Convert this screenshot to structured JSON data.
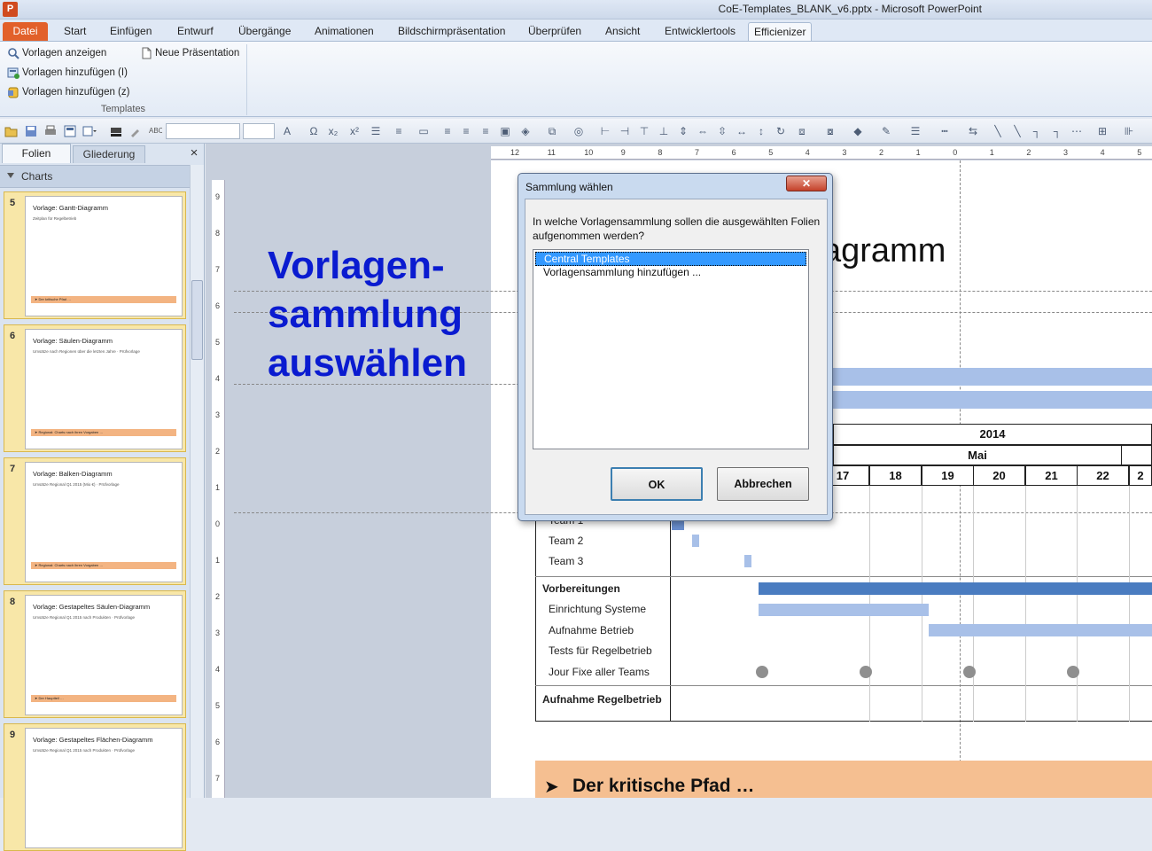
{
  "window": {
    "title": "CoE-Templates_BLANK_v6.pptx - Microsoft PowerPoint",
    "logo": "P"
  },
  "ribbon_tabs": [
    "Datei",
    "Start",
    "Einfügen",
    "Entwurf",
    "Übergänge",
    "Animationen",
    "Bildschirmpräsentation",
    "Überprüfen",
    "Ansicht",
    "Entwicklertools",
    "Efficienizer"
  ],
  "ribbon": {
    "buttons": {
      "show": "Vorlagen anzeigen",
      "new": "Neue Präsentation",
      "add_i": "Vorlagen hinzufügen (I)",
      "add_z": "Vorlagen hinzufügen (z)"
    },
    "group_label": "Templates"
  },
  "panel": {
    "tab_slides": "Folien",
    "tab_outline": "Gliederung",
    "close": "×",
    "section": "Charts",
    "slides": [
      {
        "num": "5",
        "title": "Vorlage: Gantt-Diagramm",
        "subtitle": "Zeitplan für Regelbetrieb",
        "footer": "➤ Der kritische Pfad …"
      },
      {
        "num": "6",
        "title": "Vorlage: Säulen-Diagramm",
        "subtitle": "Umsätze nach Regionen über die letzten Jahre · Prüfvorlage",
        "footer": "➤ Regional: Charts nach ihren Vorgaben …"
      },
      {
        "num": "7",
        "title": "Vorlage: Balken-Diagramm",
        "subtitle": "Umsätze Regional Q1 2015 (Mio €) · Prüfvorlage",
        "footer": "➤ Regional: Charts nach ihren Vorgaben …"
      },
      {
        "num": "8",
        "title": "Vorlage: Gestapeltes Säulen-Diagramm",
        "subtitle": "Umsätze Regional Q1 2015 nach Produkten · Prüfvorlage",
        "footer": "➤ Der Hauptteil …"
      },
      {
        "num": "9",
        "title": "Vorlage: Gestapeltes Flächen-Diagramm",
        "subtitle": "Umsätze Regional Q1 2015 nach Produkten · Prüfvorlage",
        "footer": ""
      }
    ]
  },
  "ruler": {
    "h_ticks": [
      "12",
      "11",
      "10",
      "9",
      "8",
      "7",
      "6",
      "5",
      "4",
      "3",
      "2",
      "1",
      "0",
      "1",
      "2",
      "3",
      "4",
      "5"
    ],
    "v_ticks": [
      "9",
      "8",
      "7",
      "6",
      "5",
      "4",
      "3",
      "2",
      "1",
      "0",
      "1",
      "2",
      "3",
      "4",
      "5",
      "6",
      "7"
    ]
  },
  "callout": "Vorlagen-\nsammlung\nauswählen",
  "slide": {
    "title": "agramm",
    "year": "2014",
    "month": "Mai",
    "days": [
      "17",
      "18",
      "19",
      "20",
      "21",
      "22",
      "2"
    ],
    "rows": [
      {
        "label": "Team 1",
        "bold": false
      },
      {
        "label": "Team 2",
        "bold": false
      },
      {
        "label": "Team 3",
        "bold": false
      },
      {
        "label": "Vorbereitungen",
        "bold": true
      },
      {
        "label": "Einrichtung Systeme",
        "bold": false
      },
      {
        "label": "Aufnahme Betrieb",
        "bold": false
      },
      {
        "label": "Tests für Regelbetrieb",
        "bold": false
      },
      {
        "label": "Jour Fixe aller Teams",
        "bold": false
      },
      {
        "label": "Aufnahme Regelbetrieb",
        "bold": true
      }
    ],
    "footer": "Der kritische Pfad …",
    "footer_arrow": "➤"
  },
  "dialog": {
    "title": "Sammlung wählen",
    "close": "✕",
    "question": "In welche Vorlagensammlung sollen die ausgewählten Folien aufgenommen werden?",
    "items": [
      "Central Templates",
      "Vorlagensammlung hinzufügen ..."
    ],
    "selected_index": 0,
    "ok": "OK",
    "cancel": "Abbrechen"
  },
  "colors": {
    "accent": "#e2602a",
    "selection": "#3399ff",
    "gantt_dark": "#4a7cc0",
    "gantt_light": "#a8c0e8",
    "callout": "#0a1bd0",
    "footer_band": "#f5bf91"
  }
}
